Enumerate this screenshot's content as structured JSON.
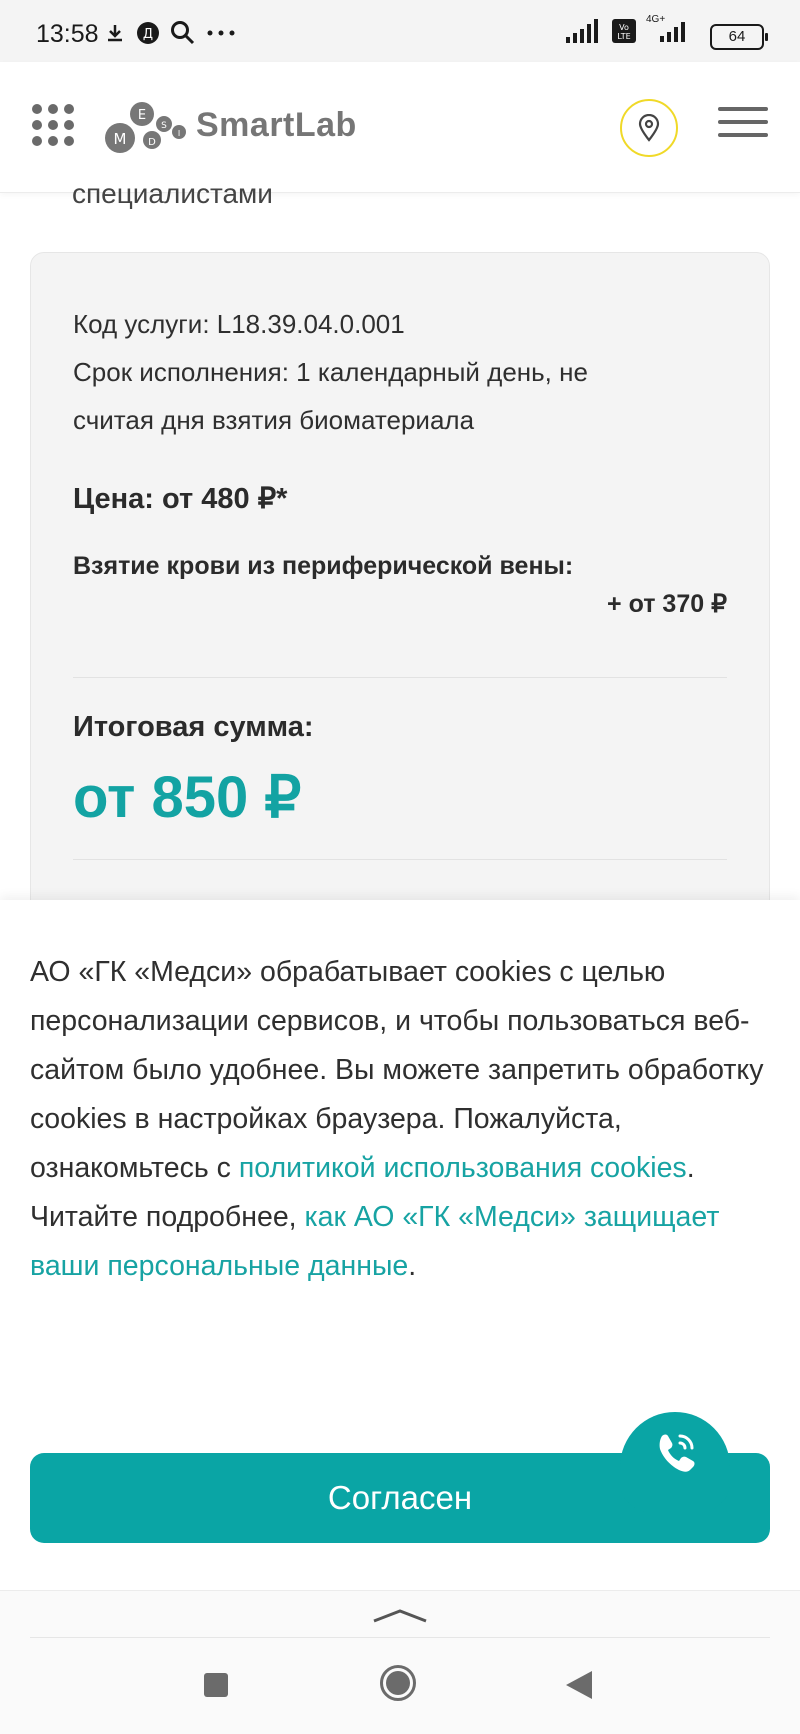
{
  "status_bar": {
    "time": "13:58",
    "battery": "64",
    "network_label": "4G+"
  },
  "header": {
    "logo_text": "SmartLab",
    "logo_letters": [
      "M",
      "E",
      "D",
      "S",
      "I"
    ]
  },
  "partial_text": "специалистами",
  "card": {
    "service_code": "Код услуги: L18.39.04.0.001",
    "term_line1": "Срок исполнения: 1 календарный день, не",
    "term_line2": "считая дня взятия биоматериала",
    "price": "Цена: от 480 ₽*",
    "blood_label": "Взятие крови из периферической вены:",
    "blood_price": "+ от 370 ₽",
    "total_label": "Итоговая сумма:",
    "total_value": "от 850 ₽"
  },
  "cookie": {
    "text_part1": "АО «ГК «Медси» обрабатывает cookies с целью персонализации сервисов, и чтобы пользоваться веб-сайтом было удобнее. Вы можете запретить обработку cookies в настройках браузера. Пожалуйста, ознакомьтесь с ",
    "link1": "политикой использования cookies",
    "text_part2": ". Читайте подробнее, ",
    "link2": "как АО «ГК «Медси» защищает ваши персональные данные",
    "text_part3": ".",
    "agree_label": "Согласен"
  },
  "colors": {
    "accent": "#0aa5a5",
    "link": "#17a3a3",
    "location_ring": "#f0d928",
    "card_bg": "#f4f4f4"
  }
}
